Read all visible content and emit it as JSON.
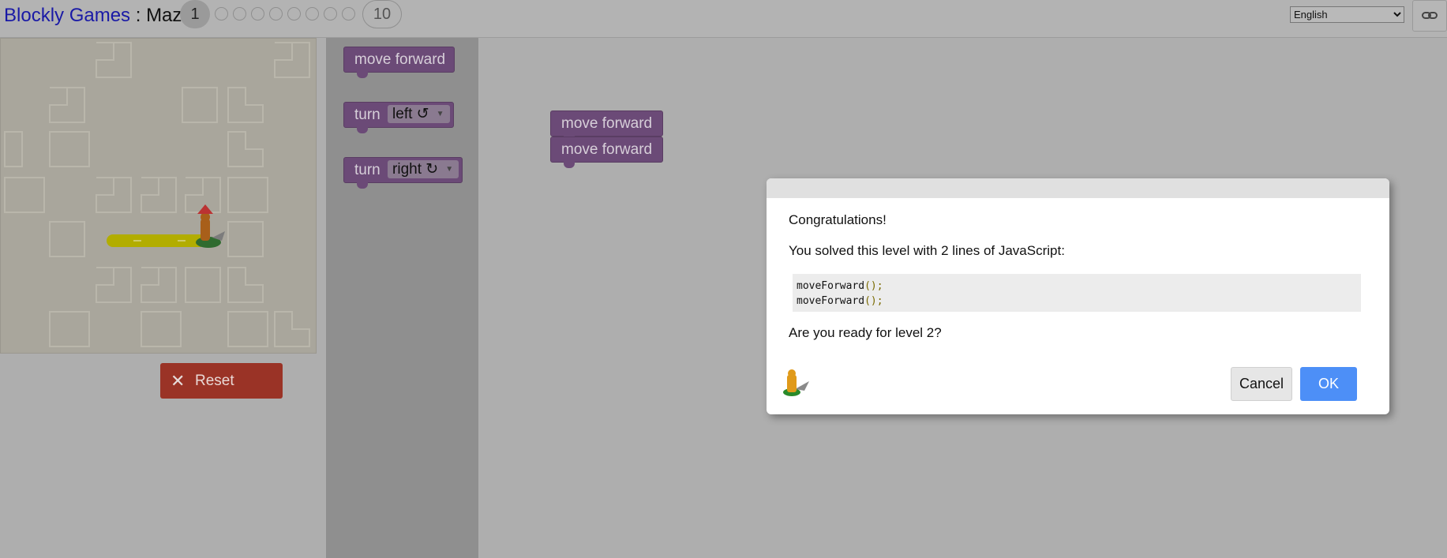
{
  "header": {
    "app_name": "Blockly Games",
    "separator": " : ",
    "game_name": "Maze",
    "levels": {
      "current": "1",
      "last": "10",
      "total_dots": 8
    },
    "language": {
      "selected": "English"
    },
    "link_icon": "link-icon"
  },
  "maze": {
    "player_icon": "pegman-icon",
    "path_color": "#d6d000"
  },
  "reset_button": {
    "label": "Reset",
    "icon": "close-icon"
  },
  "toolbox": {
    "blocks": [
      {
        "label": "move forward"
      },
      {
        "label": "turn",
        "option": "left ↺"
      },
      {
        "label": "turn",
        "option": "right ↻"
      }
    ]
  },
  "workspace": {
    "blocks": [
      {
        "label": "move forward"
      },
      {
        "label": "move forward"
      }
    ]
  },
  "dialog": {
    "congrats": "Congratulations!",
    "solved_text": "You solved this level with 2 lines of JavaScript:",
    "code_lines": [
      "moveForward",
      "moveForward"
    ],
    "code_suffix": "();",
    "ready_text": "Are you ready for level 2?",
    "cancel_label": "Cancel",
    "ok_label": "OK",
    "ok_color": "#4d8ff7"
  }
}
